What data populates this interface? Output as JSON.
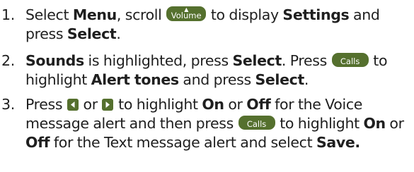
{
  "steps": [
    {
      "number": "1.",
      "t1": "Select ",
      "b1": "Menu",
      "t2": ", scroll ",
      "icon1": {
        "icon": "volume-key-icon",
        "label": "Volume",
        "arrow": "▲"
      },
      "t3": " to display ",
      "b2": "Settings",
      "t4": " and press ",
      "b3": "Select",
      "t5": "."
    },
    {
      "number": "2.",
      "b1": "Sounds",
      "t1": " is highlighted, press ",
      "b2": "Select",
      "t2": ". Press ",
      "icon1": {
        "icon": "calls-key-icon",
        "label": "Calls"
      },
      "t3": " to highlight ",
      "b3": "Alert tones",
      "t4": " and press ",
      "b4": "Select",
      "t5": "."
    },
    {
      "number": "3.",
      "t1": "Press ",
      "icon1": {
        "icon": "left-arrow-key-icon"
      },
      "t2": " or ",
      "icon2": {
        "icon": "right-arrow-key-icon"
      },
      "t3": " to highlight ",
      "b1": "On",
      "t4": " or ",
      "b2": "Off",
      "t5": " for the Voice message alert and then press ",
      "icon3": {
        "icon": "calls-key-icon",
        "label": "Calls"
      },
      "t6": " to highlight ",
      "b3": "On",
      "t7": " or ",
      "b4": "Off",
      "t8": " for the Text message alert and select ",
      "b5": "Save."
    }
  ],
  "colors": {
    "text": "#1f1f1f",
    "key_background": "#55702e",
    "key_label": "#ffffff"
  }
}
